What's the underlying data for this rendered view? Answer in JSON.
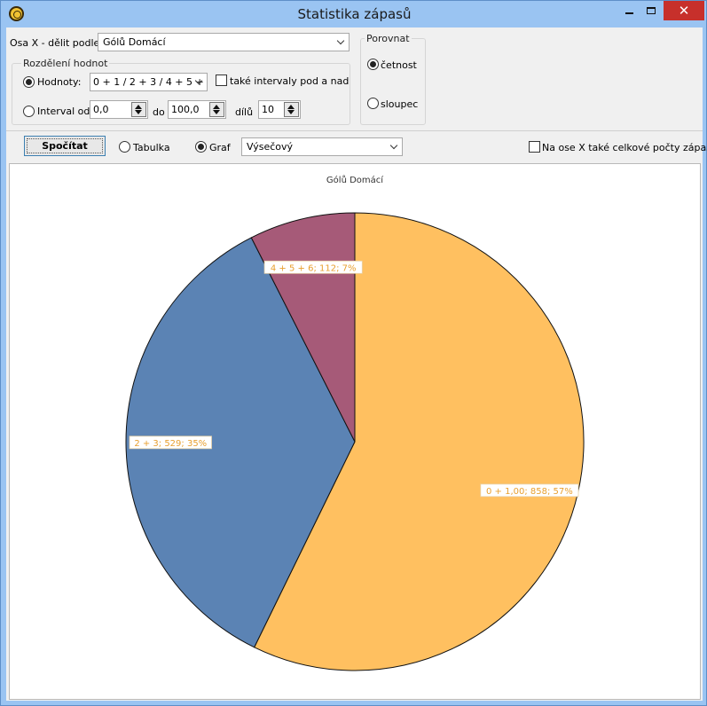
{
  "window": {
    "title": "Statistika zápasů",
    "close_glyph": "✕"
  },
  "controls": {
    "osa_x_label": "Osa X - dělit podle",
    "osa_x_value": "Gólů Domácí",
    "rozdeleni_title": "Rozdělení hodnot",
    "hodnoty_label": "Hodnoty:",
    "hodnoty_value": "0 + 1 / 2 + 3 / 4 + 5 +",
    "intervaly_label": "také intervaly pod a nad",
    "interval_label": "Interval od",
    "interval_from": "0,0",
    "do_label": "do",
    "interval_to": "100,0",
    "dilu_label": "dílů",
    "dilu_value": "10",
    "porovnat_title": "Porovnat",
    "cetnost_label": "četnost",
    "sloupec_label": "sloupec",
    "spocitat_label": "Spočítat",
    "tabulka_label": "Tabulka",
    "graf_label": "Graf",
    "graf_type_value": "Výsečový",
    "celkove_label": "Na ose X také celkové počty zápasů"
  },
  "colors": {
    "slice_orange": "#ffc060",
    "slice_blue": "#5b83b4",
    "slice_purple": "#a65a78",
    "label_text": "#e8a030"
  },
  "chart_data": {
    "type": "pie",
    "title": "Gólů Domácí",
    "slices": [
      {
        "label": "0 + 1,00; 858; 57%",
        "category": "0 + 1,00",
        "value": 858,
        "percent": 57
      },
      {
        "label": "2 + 3; 529; 35%",
        "category": "2 + 3",
        "value": 529,
        "percent": 35
      },
      {
        "label": "4 + 5 + 6; 112; 7%",
        "category": "4 + 5 + 6",
        "value": 112,
        "percent": 7
      }
    ]
  }
}
